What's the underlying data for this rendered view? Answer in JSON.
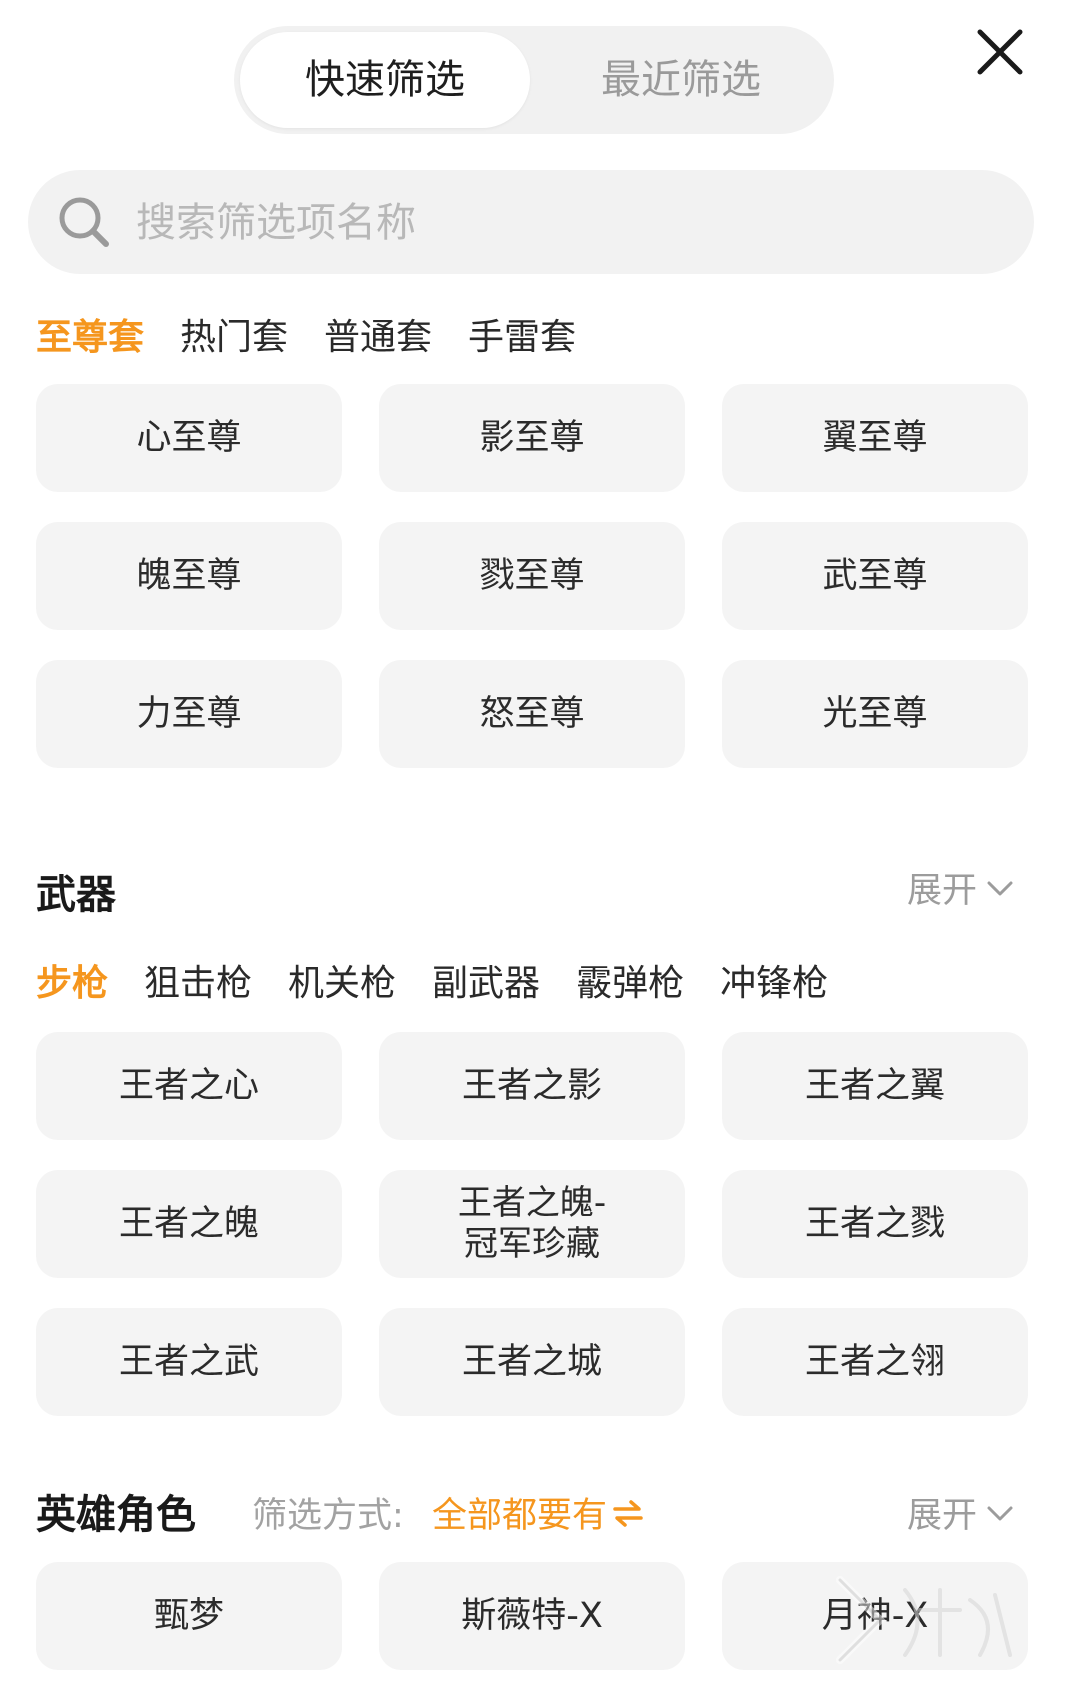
{
  "top_tabs": {
    "active": "快速筛选",
    "inactive": "最近筛选"
  },
  "search": {
    "placeholder": "搜索筛选项名称"
  },
  "suits": {
    "tabs": [
      "至尊套",
      "热门套",
      "普通套",
      "手雷套"
    ],
    "selected_index": 0,
    "items": [
      "心至尊",
      "影至尊",
      "翼至尊",
      "魄至尊",
      "戮至尊",
      "武至尊",
      "力至尊",
      "怒至尊",
      "光至尊"
    ]
  },
  "weapons": {
    "title": "武器",
    "expand_label": "展开",
    "tabs": [
      "步枪",
      "狙击枪",
      "机关枪",
      "副武器",
      "霰弹枪",
      "冲锋枪"
    ],
    "selected_index": 0,
    "items": [
      "王者之心",
      "王者之影",
      "王者之翼",
      "王者之魄",
      "王者之魄-\n冠军珍藏",
      "王者之戮",
      "王者之武",
      "王者之城",
      "王者之翎"
    ]
  },
  "heroes": {
    "title": "英雄角色",
    "mode_label": "筛选方式:",
    "mode_value": "全部都要有",
    "expand_label": "展开",
    "items": [
      "甄梦",
      "斯薇特-X",
      "月神-X"
    ]
  },
  "colors": {
    "accent": "#f5961e",
    "chip_bg": "#f4f4f4"
  }
}
